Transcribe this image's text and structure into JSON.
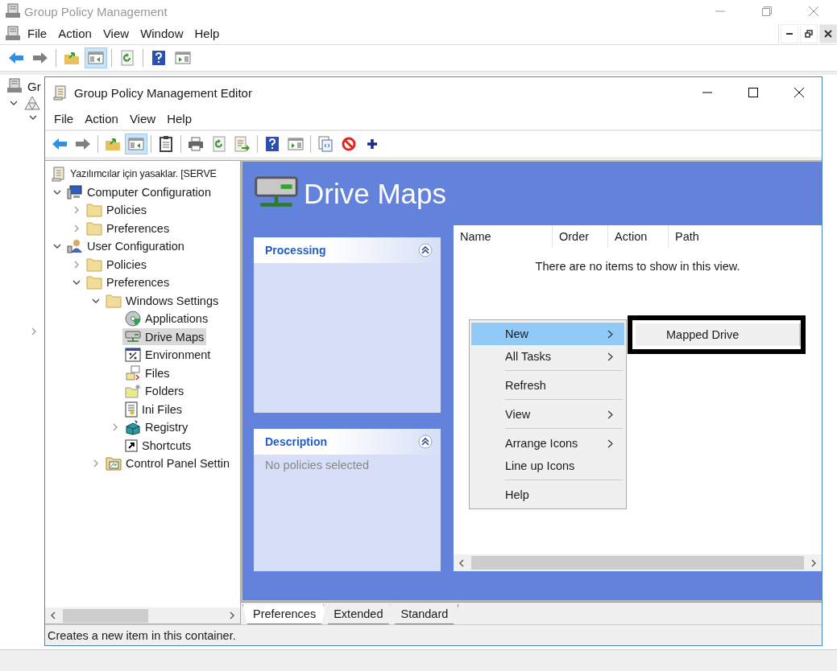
{
  "back_window": {
    "title": "Group Policy Management",
    "menu": [
      "File",
      "Action",
      "View",
      "Window",
      "Help"
    ],
    "toolbar": [
      {
        "kind": "back",
        "pressed": false
      },
      {
        "kind": "forward",
        "pressed": false
      },
      {
        "kind": "separator"
      },
      {
        "kind": "folder-up",
        "pressed": false
      },
      {
        "kind": "console-tree",
        "pressed": true
      },
      {
        "kind": "separator"
      },
      {
        "kind": "refresh",
        "pressed": false
      },
      {
        "kind": "separator"
      },
      {
        "kind": "help",
        "pressed": false
      },
      {
        "kind": "panel",
        "pressed": false
      }
    ],
    "tree_root": "Gr"
  },
  "editor": {
    "title": "Group Policy Management Editor",
    "menu": [
      "File",
      "Action",
      "View",
      "Help"
    ],
    "toolbar": [
      {
        "kind": "back",
        "pressed": false
      },
      {
        "kind": "forward",
        "pressed": false
      },
      {
        "kind": "separator"
      },
      {
        "kind": "folder-up",
        "pressed": false
      },
      {
        "kind": "console-tree",
        "pressed": true
      },
      {
        "kind": "separator"
      },
      {
        "kind": "clipboard",
        "pressed": false
      },
      {
        "kind": "separator"
      },
      {
        "kind": "print",
        "pressed": false
      },
      {
        "kind": "refresh",
        "pressed": false
      },
      {
        "kind": "export",
        "pressed": false
      },
      {
        "kind": "separator"
      },
      {
        "kind": "help",
        "pressed": false
      },
      {
        "kind": "panel",
        "pressed": false
      },
      {
        "kind": "separator"
      },
      {
        "kind": "properties",
        "pressed": false
      },
      {
        "kind": "block",
        "pressed": false
      },
      {
        "kind": "add",
        "pressed": false
      }
    ],
    "tree": {
      "label": "Yazılımcılar için yasaklar. [SERVE",
      "kind": "gpo",
      "selected": false,
      "children": [
        {
          "label": "Computer Configuration",
          "kind": "computer",
          "expanded": true,
          "selected": false,
          "children": [
            {
              "label": "Policies",
              "kind": "folder",
              "expanded": false,
              "selected": false
            },
            {
              "label": "Preferences",
              "kind": "folder",
              "expanded": false,
              "selected": false
            }
          ]
        },
        {
          "label": "User Configuration",
          "kind": "user",
          "expanded": true,
          "selected": false,
          "children": [
            {
              "label": "Policies",
              "kind": "folder",
              "expanded": false,
              "selected": false
            },
            {
              "label": "Preferences",
              "kind": "folder",
              "expanded": true,
              "selected": false,
              "children": [
                {
                  "label": "Windows Settings",
                  "kind": "folder",
                  "expanded": true,
                  "selected": false,
                  "children": [
                    {
                      "label": "Applications",
                      "kind": "applications",
                      "selected": false
                    },
                    {
                      "label": "Drive Maps",
                      "kind": "drive",
                      "selected": true
                    },
                    {
                      "label": "Environment",
                      "kind": "environment",
                      "selected": false
                    },
                    {
                      "label": "Files",
                      "kind": "files",
                      "selected": false
                    },
                    {
                      "label": "Folders",
                      "kind": "folders",
                      "selected": false
                    },
                    {
                      "label": "Ini Files",
                      "kind": "ini",
                      "selected": false
                    },
                    {
                      "label": "Registry",
                      "kind": "registry",
                      "expanded": false,
                      "selected": false
                    },
                    {
                      "label": "Shortcuts",
                      "kind": "shortcuts",
                      "selected": false
                    }
                  ]
                },
                {
                  "label": "Control Panel Settin",
                  "kind": "control-panel",
                  "expanded": false,
                  "selected": false
                }
              ]
            }
          ]
        }
      ]
    },
    "heading": "Drive Maps",
    "sections": [
      {
        "title": "Processing"
      },
      {
        "title": "Description",
        "text": "No policies selected"
      }
    ],
    "columns": [
      "Name",
      "Order",
      "Action",
      "Path"
    ],
    "empty_text": "There are no items to show in this view.",
    "context_menu": [
      [
        {
          "label": "New",
          "submenu": true,
          "selected": true
        },
        {
          "label": "All Tasks",
          "submenu": true,
          "selected": false
        }
      ],
      [
        {
          "label": "Refresh",
          "submenu": false,
          "selected": false
        }
      ],
      [
        {
          "label": "View",
          "submenu": true,
          "selected": false
        }
      ],
      [
        {
          "label": "Arrange Icons",
          "submenu": true,
          "selected": false
        },
        {
          "label": "Line up Icons",
          "submenu": false,
          "selected": false
        }
      ],
      [
        {
          "label": "Help",
          "submenu": false,
          "selected": false
        }
      ]
    ],
    "submenu": [
      "Mapped Drive"
    ],
    "tabs": [
      {
        "label": "Preferences",
        "selected": true
      },
      {
        "label": "Extended",
        "selected": false
      },
      {
        "label": "Standard",
        "selected": false
      }
    ],
    "status": "Creates a new item in this container."
  }
}
